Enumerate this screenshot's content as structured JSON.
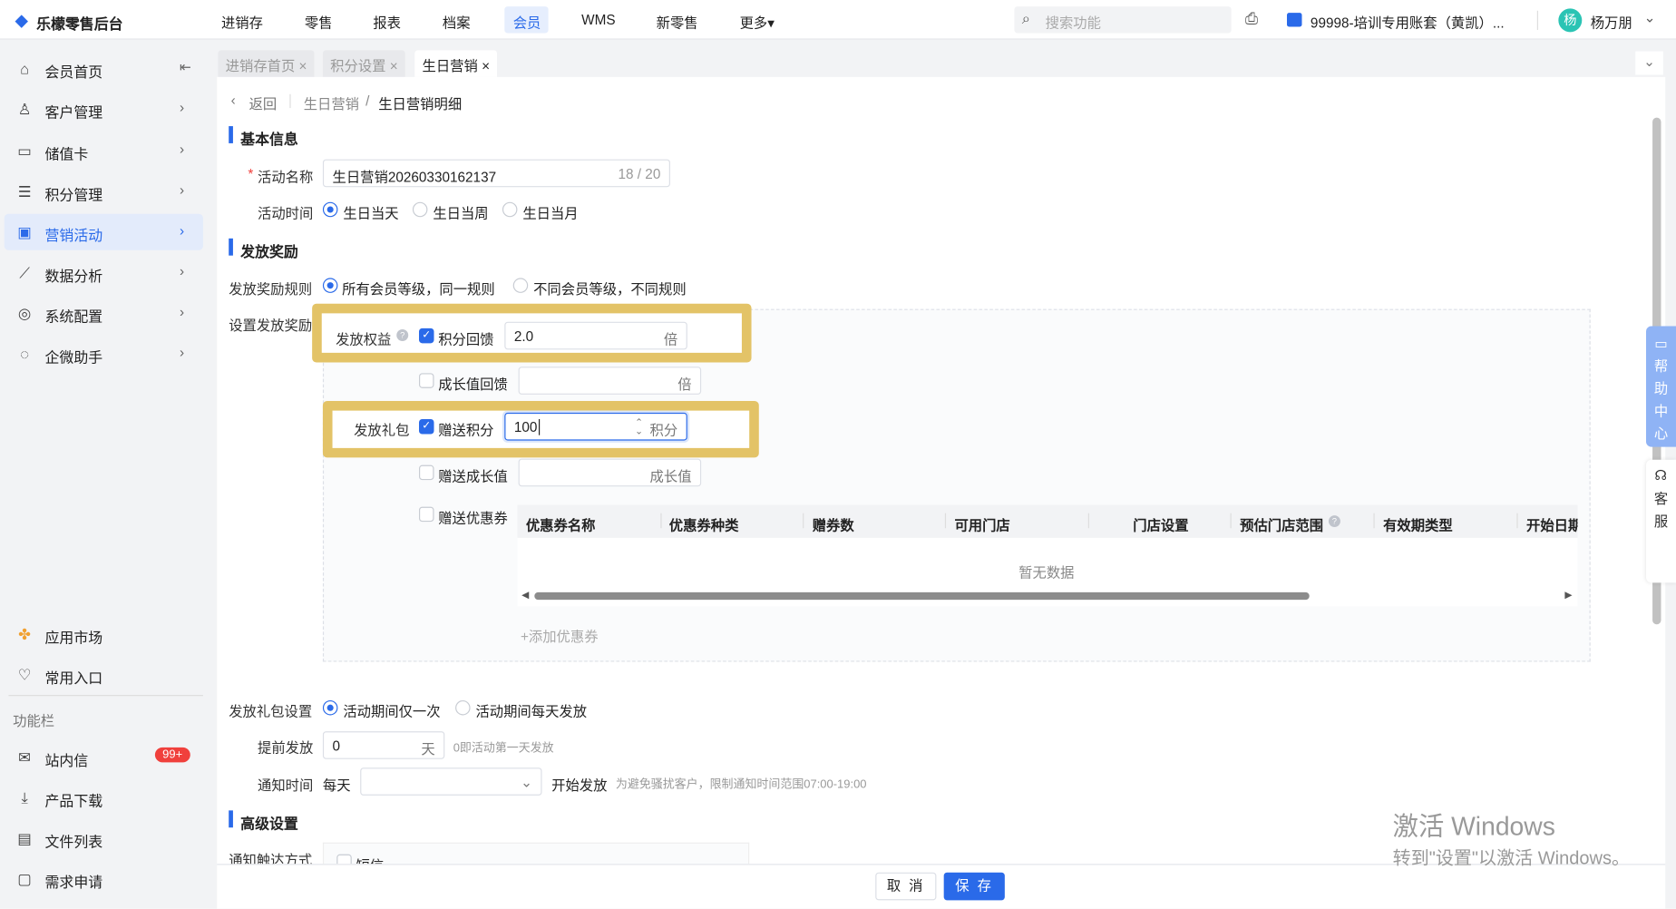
{
  "app": {
    "title": "乐檬零售后台"
  },
  "topnav": {
    "items": [
      "进销存",
      "零售",
      "报表",
      "档案",
      "会员",
      "WMS",
      "新零售",
      "更多▾"
    ],
    "active": "会员",
    "search_placeholder": "搜索功能",
    "account": "99998-培训专用账套（黄凯）...",
    "user": "杨万朋",
    "avatar_char": "杨"
  },
  "sidebar": {
    "items": [
      {
        "label": "会员首页",
        "icon": "home-icon"
      },
      {
        "label": "客户管理",
        "icon": "user-icon"
      },
      {
        "label": "储值卡",
        "icon": "card-icon"
      },
      {
        "label": "积分管理",
        "icon": "database-icon"
      },
      {
        "label": "营销活动",
        "icon": "marketing-icon"
      },
      {
        "label": "数据分析",
        "icon": "chart-icon"
      },
      {
        "label": "系统配置",
        "icon": "gear-icon"
      },
      {
        "label": "企微助手",
        "icon": "chat-icon"
      }
    ],
    "bottom": [
      {
        "label": "应用市场"
      },
      {
        "label": "常用入口"
      }
    ],
    "section_label": "功能栏",
    "tools": [
      {
        "label": "站内信",
        "badge": "99+"
      },
      {
        "label": "产品下载"
      },
      {
        "label": "文件列表"
      },
      {
        "label": "需求申请"
      }
    ]
  },
  "tabs": [
    {
      "label": "进销存首页 ×"
    },
    {
      "label": "积分设置 ×"
    },
    {
      "label": "生日营销 ×"
    }
  ],
  "breadcrumb": {
    "back": "返回",
    "parent": "生日营销",
    "sep": "/",
    "current": "生日营销明细"
  },
  "basic": {
    "title": "基本信息",
    "name_label": "活动名称",
    "name_required": "*",
    "name_value": "生日营销20260330162137",
    "name_counter": "18 / 20",
    "time_label": "活动时间",
    "time_options": [
      "生日当天",
      "生日当周",
      "生日当月"
    ]
  },
  "reward": {
    "title": "发放奖励",
    "rule_label": "发放奖励规则",
    "rule_options": [
      "所有会员等级，同一规则",
      "不同会员等级，不同规则"
    ],
    "set_label": "设置发放奖励",
    "rights_label": "发放权益",
    "points_feedback": "积分回馈",
    "points_feedback_value": "2.0",
    "times_suffix": "倍",
    "growth_feedback": "成长值回馈",
    "gift_label": "发放礼包",
    "gift_points": "赠送积分",
    "gift_points_value": "100",
    "points_suffix": "积分",
    "gift_growth": "赠送成长值",
    "growth_suffix": "成长值",
    "gift_coupon": "赠送优惠券",
    "coupon_columns": [
      "优惠券名称",
      "优惠券种类",
      "赠券数",
      "可用门店",
      "门店设置",
      "预估门店范围",
      "有效期类型",
      "开始日期"
    ],
    "empty": "暂无数据",
    "add_coupon": "+添加优惠券"
  },
  "gift_settings": {
    "label": "发放礼包设置",
    "options": [
      "活动期间仅一次",
      "活动期间每天发放"
    ],
    "advance_label": "提前发放",
    "advance_value": "0",
    "advance_suffix": "天",
    "advance_hint": "0即活动第一天发放",
    "notify_label": "通知时间",
    "notify_prefix": "每天",
    "notify_suffix": "开始发放",
    "notify_hint": "为避免骚扰客户，限制通知时间范围07:00-19:00"
  },
  "advanced": {
    "title": "高级设置",
    "reach_label": "通知触达方式",
    "sms": "短信"
  },
  "footer": {
    "cancel": "取 消",
    "save": "保 存"
  },
  "float": {
    "help": "帮助中心",
    "service": "客服"
  },
  "windows": {
    "line1": "激活 Windows",
    "line2": "转到\"设置\"以激活 Windows。"
  },
  "colors": {
    "accent": "#2a6ae9",
    "highlight": "#e3c367",
    "badge": "#f0403c"
  }
}
